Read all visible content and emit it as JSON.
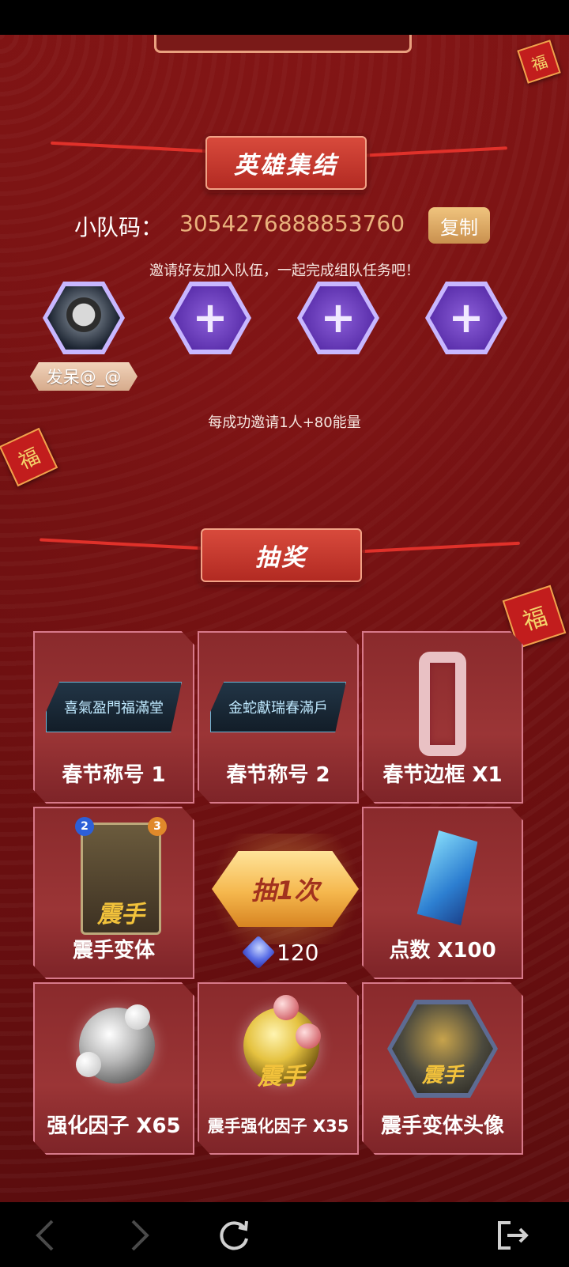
{
  "sections": {
    "team": {
      "title": "英雄集结"
    },
    "lottery": {
      "title": "抽奖"
    }
  },
  "team": {
    "code_label": "小队码：",
    "code_value": "3054276888853760",
    "copy_button": "复制",
    "invite_tip": "邀请好友加入队伍，一起完成组队任务吧！",
    "members": [
      {
        "type": "avatar",
        "name": "发呆@_@"
      },
      {
        "type": "empty",
        "icon": "plus-icon"
      },
      {
        "type": "empty",
        "icon": "plus-icon"
      },
      {
        "type": "empty",
        "icon": "plus-icon"
      }
    ],
    "energy_tip": "每成功邀请1人+80能量"
  },
  "prizes": [
    {
      "label": "春节称号 1",
      "title_text": "喜氣盈門福滿堂"
    },
    {
      "label": "春节称号 2",
      "title_text": "金蛇獻瑞春滿戶"
    },
    {
      "label": "春节边框 X1"
    },
    {
      "label": "震手变体",
      "cost": "2",
      "power": "3",
      "logo": "震手"
    },
    {
      "label": "点数 X100"
    },
    {
      "label": "强化因子 X65"
    },
    {
      "label": "震手强化因子 X35",
      "logo": "震手"
    },
    {
      "label": "震手变体头像",
      "logo": "震手"
    }
  ],
  "draw": {
    "button_label": "抽1次",
    "cost": "120",
    "cost_icon": "gem-icon"
  },
  "decor": {
    "fu": "福"
  },
  "navbar": {
    "back_icon": "chevron-left-icon",
    "forward_icon": "chevron-right-icon",
    "reload_icon": "reload-icon",
    "exit_icon": "exit-icon"
  },
  "colors": {
    "background": "#6b0f10",
    "accent_gold": "#e9b27d",
    "section_line": "#e0312a",
    "card_border": "#d7798a"
  }
}
